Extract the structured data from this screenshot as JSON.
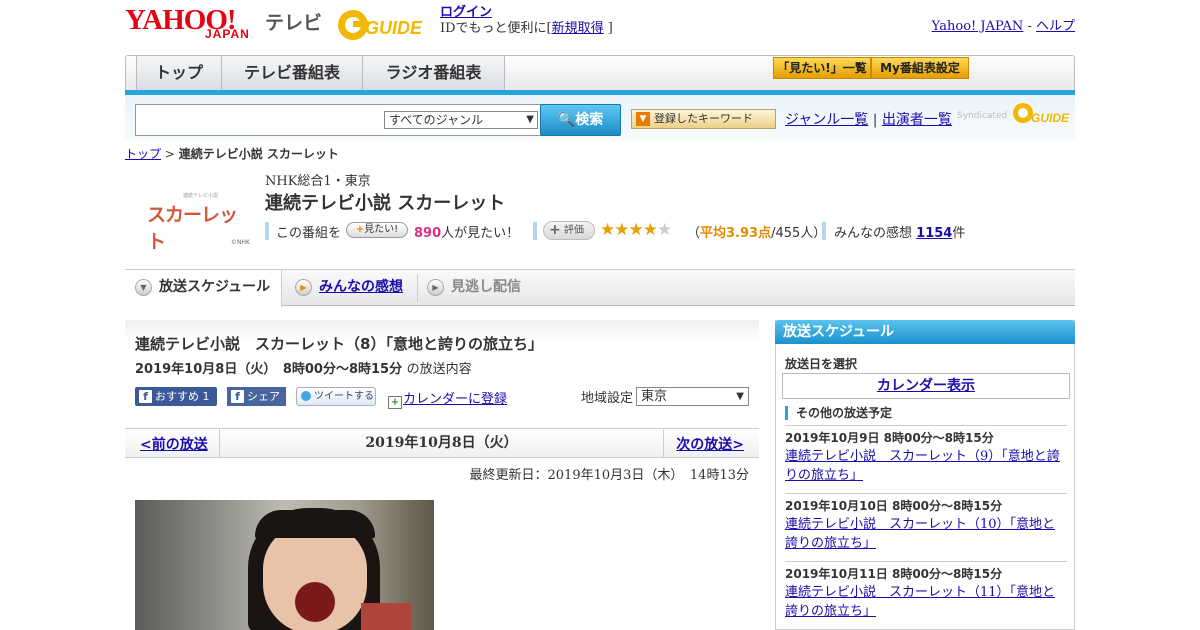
{
  "header": {
    "logo_yahoo": "YAHOO!",
    "logo_japan": "JAPAN",
    "logo_tv": "テレビ",
    "gguide_label": "GUIDE",
    "login_link": "ログイン",
    "login_text": "IDでもっと便利に[",
    "signup_link": "新規取得",
    "login_close": "]",
    "yahoo_japan_link": "Yahoo! JAPAN",
    "sep": "-",
    "help_link": "ヘルプ"
  },
  "nav": {
    "tabs": [
      {
        "label": "トップ"
      },
      {
        "label": "テレビ番組表"
      },
      {
        "label": "ラジオ番組表"
      }
    ],
    "mitai_list": "「見たい!」一覧",
    "my_schedule": "My番組表設定"
  },
  "search": {
    "genre_selected": "すべてのジャンル",
    "search_button": "検索",
    "keyword_button": "登録したキーワード",
    "genre_list_link": "ジャンル一覧",
    "divider": "|",
    "performer_list_link": "出演者一覧",
    "syndicated": "Syndicated"
  },
  "breadcrumb": {
    "top": "トップ",
    "sep": ">",
    "current": "連続テレビ小説 スカーレット"
  },
  "program": {
    "logo_brand": "スカーレット",
    "logo_small": "連続テレビ小説",
    "logo_copyright": "©NHK",
    "channel": "NHK総合1・東京",
    "title": "連続テレビ小説 スカーレット",
    "want_prefix": "この番組を",
    "want_button": "見たい!",
    "want_count": "890",
    "want_suffix": "人が見たい！",
    "rate_button": "評価",
    "rating_open": "（",
    "rating_avg_label": "平均3.93点",
    "rating_count": "/455人）",
    "rating_value": 3.93,
    "impressions_label": "みんなの感想",
    "impressions_count": "1154",
    "impressions_suffix": "件"
  },
  "tabs": {
    "schedule": "放送スケジュール",
    "impressions": "みんなの感想",
    "catchup": "見逃し配信"
  },
  "episode": {
    "title": "連続テレビ小説　スカーレット（8）「意地と誇りの旅立ち」",
    "date_time": "2019年10月8日（火）　8時00分～8時15分",
    "date_suffix": "の放送内容",
    "fb_recommend": "おすすめ 1",
    "fb_share": "シェア",
    "tweet": "ツイートする",
    "calendar_register": "カレンダーに登録",
    "region_label": "地域設定",
    "region_selected": "東京",
    "prev": "<前の放送",
    "current_date": "2019年10月8日（火）",
    "next": "次の放送>",
    "updated": "最終更新日：2019年10月3日（木）　14時13分"
  },
  "sidebar": {
    "title": "放送スケジュール",
    "select_date": "放送日を選択",
    "calendar_button": "カレンダー表示",
    "other_title": "その他の放送予定",
    "schedules": [
      {
        "datetime": "2019年10月9日  8時00分～8時15分",
        "title": "連続テレビ小説　スカーレット（9）「意地と誇りの旅立ち」"
      },
      {
        "datetime": "2019年10月10日  8時00分～8時15分",
        "title": "連続テレビ小説　スカーレット（10）「意地と誇りの旅立ち」"
      },
      {
        "datetime": "2019年10月11日  8時00分～8時15分",
        "title": "連続テレビ小説　スカーレット（11）「意地と誇りの旅立ち」"
      }
    ]
  },
  "colors": {
    "accent_blue": "#26a4dc",
    "yahoo_red": "#e60012",
    "gguide_yellow": "#f2b800",
    "want_pink": "#d9337e",
    "rating_orange": "#e48a00"
  }
}
